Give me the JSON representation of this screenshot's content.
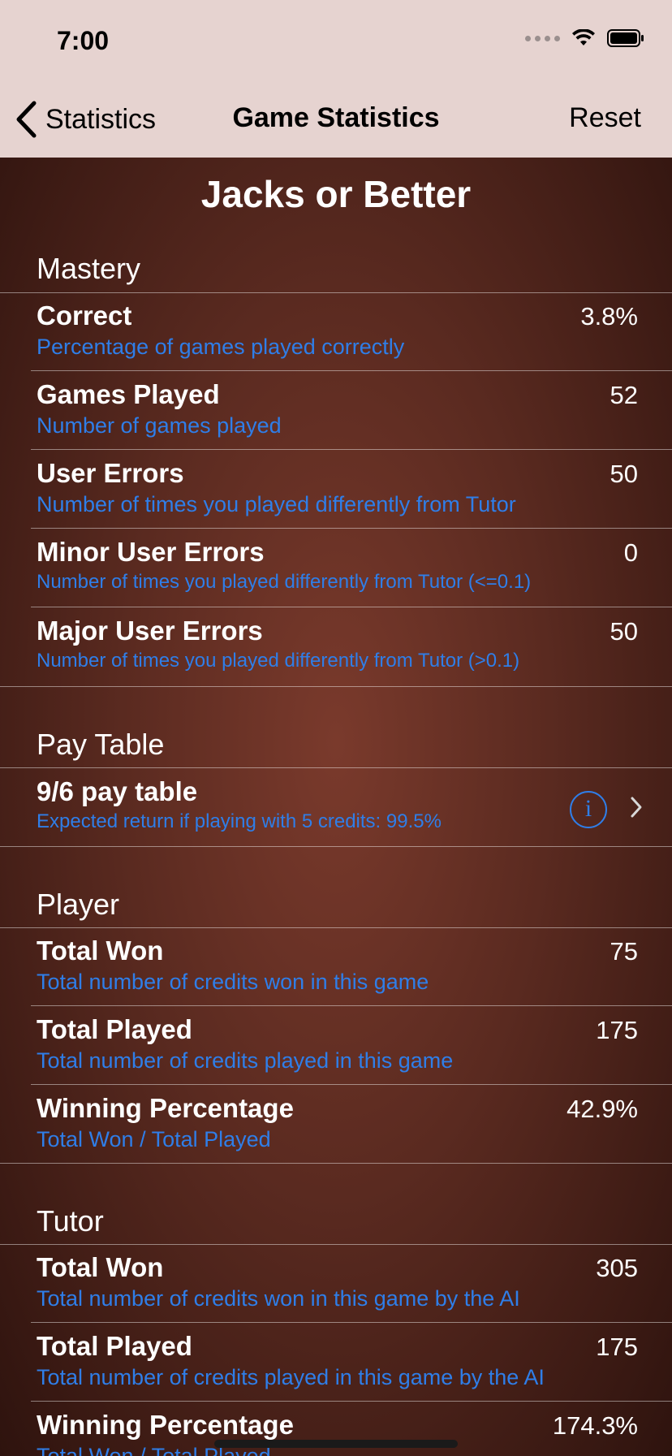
{
  "status": {
    "time": "7:00"
  },
  "nav": {
    "back_label": "Statistics",
    "title": "Game Statistics",
    "reset_label": "Reset"
  },
  "game_title": "Jacks or Better",
  "mastery": {
    "header": "Mastery",
    "rows": [
      {
        "title": "Correct",
        "value": "3.8%",
        "sub": "Percentage of games played correctly"
      },
      {
        "title": "Games Played",
        "value": "52",
        "sub": "Number of games played"
      },
      {
        "title": "User Errors",
        "value": "50",
        "sub": "Number of times you played differently from Tutor"
      },
      {
        "title": "Minor User Errors",
        "value": "0",
        "sub": "Number of times you played differently from Tutor (<=0.1)"
      },
      {
        "title": "Major User Errors",
        "value": "50",
        "sub": "Number of times you played differently from Tutor (>0.1)"
      }
    ]
  },
  "pay_table": {
    "header": "Pay Table",
    "row": {
      "title": "9/6 pay table",
      "sub": "Expected return if playing with 5 credits: 99.5%"
    }
  },
  "player": {
    "header": "Player",
    "rows": [
      {
        "title": "Total Won",
        "value": "75",
        "sub": "Total number of credits won in this game"
      },
      {
        "title": "Total Played",
        "value": "175",
        "sub": "Total number of credits played in this game"
      },
      {
        "title": "Winning Percentage",
        "value": "42.9%",
        "sub": "Total Won / Total Played"
      }
    ]
  },
  "tutor": {
    "header": "Tutor",
    "rows": [
      {
        "title": "Total Won",
        "value": "305",
        "sub": "Total number of credits won in this game by the AI"
      },
      {
        "title": "Total Played",
        "value": "175",
        "sub": "Total number of credits played in this game by the AI"
      },
      {
        "title": "Winning Percentage",
        "value": "174.3%",
        "sub": "Total Won / Total Played"
      }
    ]
  }
}
